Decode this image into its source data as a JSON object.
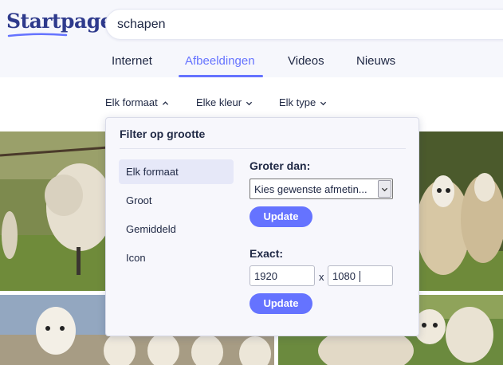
{
  "brand": {
    "logo_text": "Startpage",
    "accent_color": "#6573ff",
    "logo_color": "#2e3a8c"
  },
  "search": {
    "query": "schapen"
  },
  "tabs": [
    {
      "label": "Internet",
      "active": false
    },
    {
      "label": "Afbeeldingen",
      "active": true
    },
    {
      "label": "Videos",
      "active": false
    },
    {
      "label": "Nieuws",
      "active": false
    }
  ],
  "filters": {
    "format_label": "Elk formaat",
    "color_label": "Elke kleur",
    "type_label": "Elk type"
  },
  "size_popup": {
    "title": "Filter op grootte",
    "options": [
      {
        "label": "Elk formaat",
        "selected": true
      },
      {
        "label": "Groot",
        "selected": false
      },
      {
        "label": "Gemiddeld",
        "selected": false
      },
      {
        "label": "Icon",
        "selected": false
      }
    ],
    "larger_than": {
      "label": "Groter dan:",
      "select_value": "Kies gewenste afmetin...",
      "button_label": "Update"
    },
    "exact": {
      "label": "Exact:",
      "width_value": "1920",
      "separator": "x",
      "height_value": "1080",
      "button_label": "Update"
    }
  },
  "images": [
    {
      "subject": "sheep-photo"
    },
    {
      "subject": "sheep-photo"
    },
    {
      "subject": "sheep-photo"
    },
    {
      "subject": "sheep-photo"
    }
  ]
}
